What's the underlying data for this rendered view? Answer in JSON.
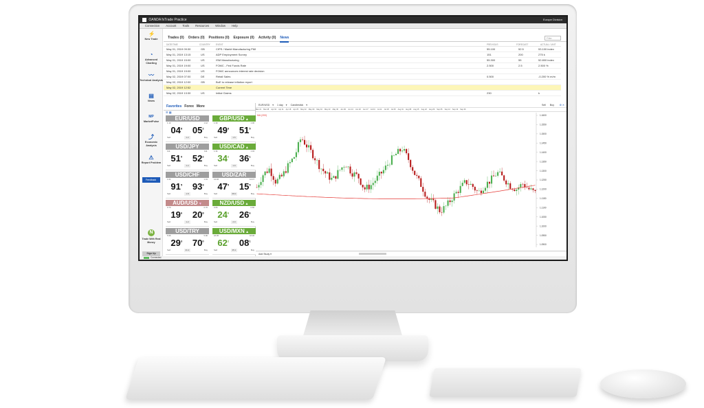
{
  "app": {
    "title": "OANDA fxTrade Practice",
    "region": "Europe Division"
  },
  "menu": [
    "Connection",
    "Account",
    "Tools",
    "Resources",
    "Window",
    "Help"
  ],
  "sidebar": [
    {
      "label": "New Trade",
      "icon": "new-trade-icon"
    },
    {
      "label": "Advanced Charting",
      "icon": "advanced-charting-icon"
    },
    {
      "label": "Technical Analysis",
      "icon": "technical-analysis-icon"
    },
    {
      "label": "News",
      "icon": "news-icon"
    },
    {
      "label": "MarketPulse",
      "icon": "marketpulse-icon"
    },
    {
      "label": "Economic Analysis",
      "icon": "economic-analysis-icon"
    },
    {
      "label": "Report Problem",
      "icon": "report-problem-icon"
    }
  ],
  "feedback_label": "Feedback",
  "trade_real": "Trade With Real Money",
  "signup_label": "Sign Up",
  "status_text": "Connected",
  "tabs": [
    "Trades (0)",
    "Orders (0)",
    "Positions (0)",
    "Exposure (0)",
    "Activity (0)",
    "News"
  ],
  "active_tab": "News",
  "filter_placeholder": "Filter",
  "news_headers": [
    "DATE/TIME",
    "COUNTRY",
    "EVENT",
    "PREVIOUS",
    "FORECAST",
    "ACTUAL / UNIT"
  ],
  "news": [
    {
      "date": "May 01, 2019 09:30",
      "country": "GB",
      "event": "CIPS / Markit Manufacturing PMI",
      "previous": "55.100",
      "forecast": "52.5",
      "actual": "53.100 index"
    },
    {
      "date": "May 01, 2019 13:15",
      "country": "US",
      "event": "ADP Employment Survey",
      "previous": "151",
      "forecast": "200",
      "actual": "275 k"
    },
    {
      "date": "May 01, 2019 15:00",
      "country": "US",
      "event": "ISM Manufacturing",
      "previous": "55.300",
      "forecast": "55",
      "actual": "52.800 index"
    },
    {
      "date": "May 01, 2019 19:00",
      "country": "US",
      "event": "FOMC - Fed Funds Rate",
      "previous": "2.500",
      "forecast": "2.5",
      "actual": "2.500 %"
    },
    {
      "date": "May 01, 2019 19:00",
      "country": "US",
      "event": "FOMC announces interest rate decision",
      "previous": "",
      "forecast": "",
      "actual": ""
    },
    {
      "date": "May 02, 2019 07:00",
      "country": "DE",
      "event": "Retail Sales",
      "previous": "0.500",
      "forecast": "",
      "actual": "-0.200 % m/m"
    },
    {
      "date": "May 02, 2019 12:00",
      "country": "GB",
      "event": "BoE to release inflation report",
      "previous": "",
      "forecast": "",
      "actual": ""
    },
    {
      "date": "May 02, 2019 12:52",
      "country": "",
      "event": "Current Time",
      "previous": "",
      "forecast": "",
      "actual": ""
    },
    {
      "date": "May 02, 2019 13:30",
      "country": "US",
      "event": "Initial Claims",
      "previous": "230",
      "forecast": "",
      "actual": "k"
    }
  ],
  "watchlist_tabs": [
    "Favorites",
    "Forex",
    "More"
  ],
  "watchlist": [
    {
      "pair": "EUR/USD",
      "color": "#9e9e9e",
      "arrow": "",
      "bid": "04",
      "ask": "05",
      "bsup": "8",
      "asup": "2",
      "spread": "1.2",
      "bl": "1.12",
      "al": "1.12"
    },
    {
      "pair": "GBP/USD",
      "color": "#6aab3a",
      "arrow": "▲",
      "bid": "49",
      "ask": "51",
      "bsup": "8",
      "asup": "5",
      "spread": "1.6",
      "bl": "1.30",
      "al": "1.30"
    },
    {
      "pair": "USD/JPY",
      "color": "#9e9e9e",
      "arrow": "",
      "bid": "51",
      "ask": "52",
      "bsup": "0",
      "asup": "2",
      "spread": "1.2",
      "bl": "111.",
      "al": "111."
    },
    {
      "pair": "USD/CAD",
      "color": "#6aab3a",
      "arrow": "▲",
      "bid": "34",
      "ask": "36",
      "bsup": "2",
      "asup": "1",
      "spread": "1.9",
      "bl": "1.34",
      "al": "1.34"
    },
    {
      "pair": "USD/CHF",
      "color": "#9e9e9e",
      "arrow": "",
      "bid": "91",
      "ask": "93",
      "bsup": "5",
      "asup": "3",
      "spread": "1.8",
      "bl": "1.01",
      "al": "1.01"
    },
    {
      "pair": "USD/ZAR",
      "color": "#9e9e9e",
      "arrow": "",
      "bid": "47",
      "ask": "15",
      "bsup": "5",
      "asup": "5",
      "spread": "68.0",
      "bl": "14.46",
      "al": "14.47"
    },
    {
      "pair": "AUD/USD",
      "color": "#c38a8a",
      "arrow": "▼",
      "bid": "19",
      "ask": "20",
      "bsup": "6",
      "asup": "8",
      "spread": "1.2",
      "bl": "0.70",
      "al": "0.70"
    },
    {
      "pair": "NZD/USD",
      "color": "#6aab3a",
      "arrow": "▲",
      "bid": "24",
      "ask": "26",
      "bsup": "6",
      "asup": "6",
      "spread": "2.0",
      "bl": "0.66",
      "al": "0.66"
    },
    {
      "pair": "USD/TRY",
      "color": "#9e9e9e",
      "arrow": "",
      "bid": "29",
      "ask": "70",
      "bsup": "3",
      "asup": "0",
      "spread": "41.2",
      "bl": "5.96",
      "al": "5.96"
    },
    {
      "pair": "USD/MXN",
      "color": "#6aab3a",
      "arrow": "▲",
      "bid": "62",
      "ask": "08",
      "bsup": "2",
      "asup": "1",
      "spread": "45.1",
      "bl": "18.95",
      "al": "18.96"
    }
  ],
  "sell_label": "Sell",
  "buy_label": "Buy",
  "chart_toolbar": {
    "instrument": "EUR/USD",
    "granularity": "1 day",
    "style": "Candlestick",
    "sell": "Sell",
    "buy": "Buy"
  },
  "chart_dates": [
    "Mar 21",
    "Mar 28",
    "Apr 04",
    "Apr 11",
    "Apr 18",
    "Apr 25",
    "May 02",
    "May 09",
    "May 16",
    "May 23",
    "May 30",
    "Jun 06",
    "Jun 13",
    "Jun 20",
    "Jun 27",
    "Jul 04",
    "Jul 11",
    "Jul 18",
    "Jul 25",
    "Aug 01",
    "Aug 08",
    "Aug 15",
    "Aug 22",
    "Aug 29",
    "Sep 05",
    "Sep 12",
    "Sep 19",
    "Sep 26"
  ],
  "indicator_label": "MA (200)",
  "add_study": "Add Study",
  "y_ticks": [
    "1.1600",
    "1.1550",
    "1.1500",
    "1.1450",
    "1.1400",
    "1.1350",
    "1.1300",
    "1.1250",
    "1.1200",
    "1.1150",
    "1.1100",
    "1.1050",
    "1.1000",
    "1.0950",
    "1.0900"
  ],
  "colors": {
    "up": "#4caf50",
    "down": "#b71c1c",
    "ma": "#e53935",
    "accent": "#1e5bb8"
  }
}
